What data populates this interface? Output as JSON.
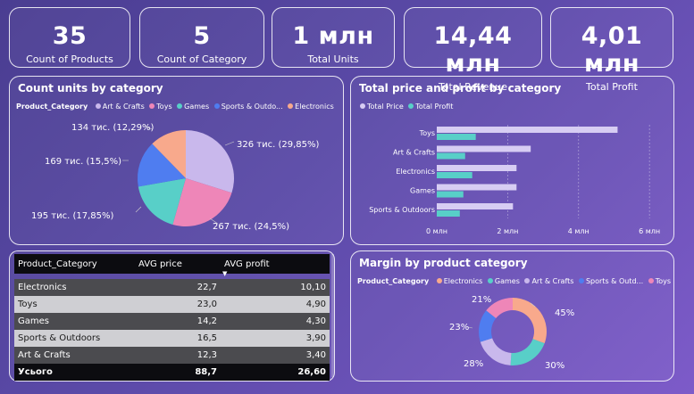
{
  "kpis": [
    {
      "value": "35",
      "label": "Count of Products"
    },
    {
      "value": "5",
      "label": "Count of Category"
    },
    {
      "value": "1 млн",
      "label": "Total Units"
    },
    {
      "value": "14,44 млн",
      "label": "Total Revenue"
    },
    {
      "value": "4,01 млн",
      "label": "Total Profit"
    }
  ],
  "pie": {
    "title": "Count units by category",
    "legend_title": "Product_Category",
    "legend": [
      {
        "name": "Art & Crafts",
        "color": "#c9b8ec"
      },
      {
        "name": "Toys",
        "color": "#ee86b8"
      },
      {
        "name": "Games",
        "color": "#58cfc8"
      },
      {
        "name": "Sports & Outdo...",
        "color": "#4f7df0"
      },
      {
        "name": "Electronics",
        "color": "#f8a98c"
      }
    ],
    "labels": [
      "326 тис. (29,85%)",
      "267 тис. (24,5%)",
      "195 тис. (17,85%)",
      "169 тис. (15,5%)",
      "134 тис. (12,29%)"
    ]
  },
  "bars": {
    "title": "Total price and profit by category",
    "legend": [
      {
        "name": "Total Price",
        "color": "#d7cdf3"
      },
      {
        "name": "Total Profit",
        "color": "#58cfc8"
      }
    ],
    "x_ticks": [
      "0 млн",
      "2 млн",
      "4 млн",
      "6 млн"
    ]
  },
  "table": {
    "headers": [
      "Product_Category",
      "AVG price",
      "AVG profit"
    ],
    "rows": [
      {
        "cat": "Electronics",
        "price": "22,7",
        "profit": "10,10"
      },
      {
        "cat": "Toys",
        "price": "23,0",
        "profit": "4,90"
      },
      {
        "cat": "Games",
        "price": "14,2",
        "profit": "4,30"
      },
      {
        "cat": "Sports & Outdoors",
        "price": "16,5",
        "profit": "3,90"
      },
      {
        "cat": "Art & Crafts",
        "price": "12,3",
        "profit": "3,40"
      }
    ],
    "total": {
      "cat": "Усього",
      "price": "88,7",
      "profit": "26,60"
    }
  },
  "donut": {
    "title": "Margin by product category",
    "legend_title": "Product_Category",
    "legend": [
      {
        "name": "Electronics",
        "color": "#f8a98c"
      },
      {
        "name": "Games",
        "color": "#58cfc8"
      },
      {
        "name": "Art & Crafts",
        "color": "#c9b8ec"
      },
      {
        "name": "Sports & Outd...",
        "color": "#4f7df0"
      },
      {
        "name": "Toys",
        "color": "#ee86b8"
      }
    ],
    "labels": [
      "45%",
      "30%",
      "28%",
      "23%",
      "21%"
    ]
  },
  "chart_data": [
    {
      "type": "pie",
      "title": "Count units by category",
      "categories": [
        "Art & Crafts",
        "Toys",
        "Games",
        "Sports & Outdoors",
        "Electronics"
      ],
      "values": [
        326000,
        267000,
        195000,
        169000,
        134000
      ],
      "percent": [
        29.85,
        24.5,
        17.85,
        15.5,
        12.29
      ],
      "colors": [
        "#c9b8ec",
        "#ee86b8",
        "#58cfc8",
        "#4f7df0",
        "#f8a98c"
      ]
    },
    {
      "type": "bar",
      "orientation": "horizontal",
      "title": "Total price and profit by category",
      "categories": [
        "Toys",
        "Art & Crafts",
        "Electronics",
        "Games",
        "Sports & Outdoors"
      ],
      "series": [
        {
          "name": "Total Price",
          "values": [
            5.1,
            2.65,
            2.25,
            2.25,
            2.15
          ],
          "color": "#d7cdf3"
        },
        {
          "name": "Total Profit",
          "values": [
            1.1,
            0.8,
            1.0,
            0.75,
            0.65
          ],
          "color": "#58cfc8"
        }
      ],
      "xlim": [
        0,
        6.5
      ]
    },
    {
      "type": "pie",
      "subtype": "donut",
      "title": "Margin by product category",
      "categories": [
        "Electronics",
        "Games",
        "Art & Crafts",
        "Sports & Outdoors",
        "Toys"
      ],
      "values": [
        45,
        30,
        28,
        23,
        21
      ],
      "colors": [
        "#f8a98c",
        "#58cfc8",
        "#c9b8ec",
        "#4f7df0",
        "#ee86b8"
      ]
    }
  ]
}
